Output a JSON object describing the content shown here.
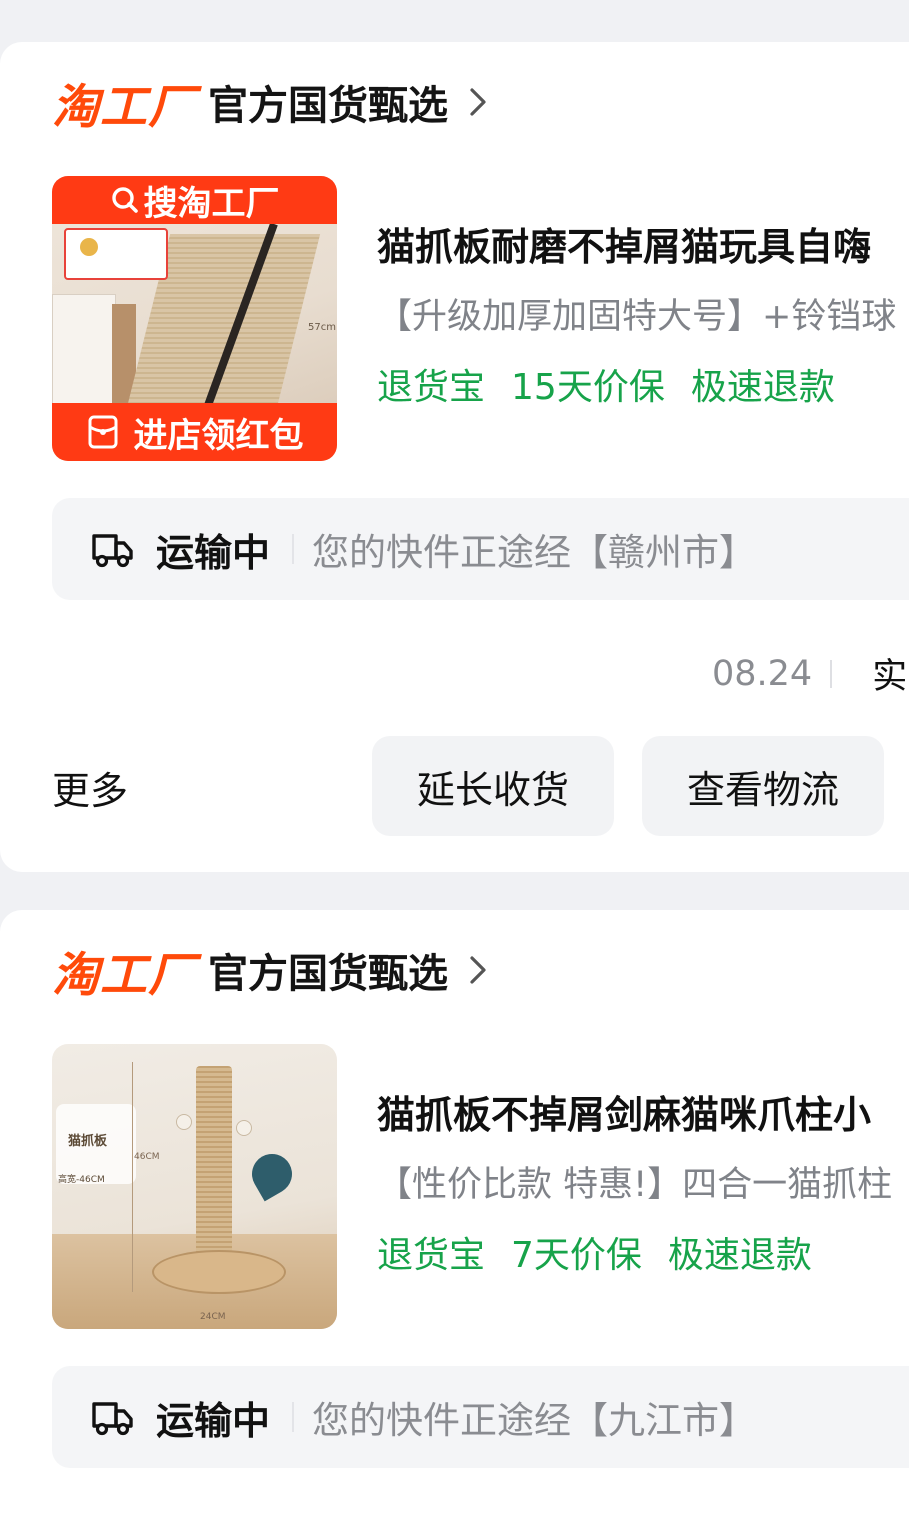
{
  "orders": [
    {
      "shop": {
        "logo_text": "淘工厂",
        "name": "官方国货甄选"
      },
      "thumb": {
        "banner_top": "搜淘工厂",
        "banner_bottom": "进店领红包",
        "dimension_label": "57cm"
      },
      "title": "猫抓板耐磨不掉屑猫玩具自嗨",
      "subtitle": "【升级加厚加固特大号】+铃铛球",
      "tags": [
        "退货宝",
        "15天价保",
        "极速退款"
      ],
      "logistics": {
        "status": "运输中",
        "message": "您的快件正途经【赣州市】"
      },
      "date": "08.24",
      "date_extra": "实",
      "more_label": "更多",
      "buttons": {
        "extend": "延长收货",
        "logistics": "查看物流"
      }
    },
    {
      "shop": {
        "logo_text": "淘工厂",
        "name": "官方国货甄选"
      },
      "thumb": {
        "badge_title": "猫抓板",
        "badge_size": "高宽-46CM",
        "height_label": "46CM",
        "width_label": "24CM"
      },
      "title": "猫抓板不掉屑剑麻猫咪爪柱小",
      "subtitle": "【性价比款 特惠!】四合一猫抓柱",
      "tags": [
        "退货宝",
        "7天价保",
        "极速退款"
      ],
      "logistics": {
        "status": "运输中",
        "message": "您的快件正途经【九江市】"
      }
    }
  ],
  "colors": {
    "brand_orange": "#ff4a0a",
    "banner_red": "#ff3a14",
    "tag_green": "#17a34a",
    "muted_text": "#8a8c91",
    "page_bg": "#f0f1f4"
  },
  "icons": {
    "chevron": "chevron-right-icon",
    "truck": "truck-icon",
    "search": "search-icon",
    "red_packet": "red-packet-icon"
  }
}
